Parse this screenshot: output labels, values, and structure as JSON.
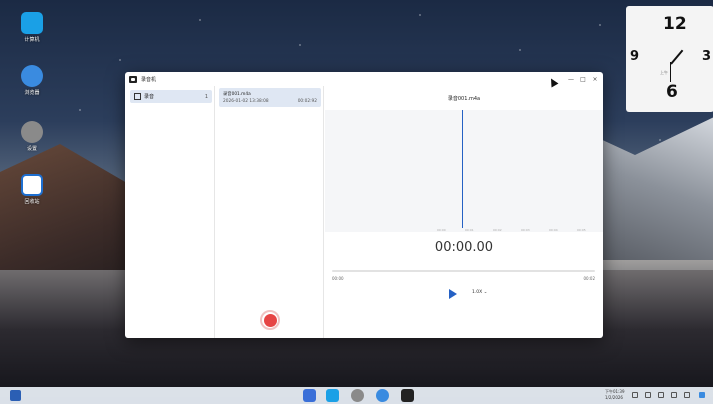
{
  "desktop": {
    "icons": [
      {
        "label": "计算机",
        "name": "computer-icon",
        "color": "#1aa0e6"
      },
      {
        "label": "浏览器",
        "name": "browser-icon",
        "color": "#3a8be0"
      },
      {
        "label": "设置",
        "name": "settings-icon",
        "color": "#8a8a8a"
      },
      {
        "label": "回收站",
        "name": "trash-icon",
        "color": "#1e6fd0"
      }
    ]
  },
  "clock": {
    "numbers": [
      "12",
      "9",
      "3",
      "6"
    ],
    "time_label": "上午"
  },
  "window": {
    "title": "录音机",
    "controls": {
      "minimize": "—",
      "maximize": "□",
      "close": "×"
    },
    "sidebar": {
      "items": [
        {
          "label": "录音",
          "count": "1"
        }
      ]
    },
    "files": [
      {
        "name": "录音001.m4a",
        "date": "2026-01-02 13:38:08",
        "duration": "00:02:92"
      }
    ],
    "player": {
      "file_title": "录音001.m4a",
      "ruler_ticks": [
        "00:00",
        "00:01",
        "00:02",
        "00:03",
        "00:04",
        "00:05"
      ],
      "current_time": "00:00.00",
      "start_time": "00:00",
      "end_time": "00:02",
      "speed": "1.0X ⌄",
      "progress_fraction": 0
    },
    "accent": "#2561c4",
    "record_color": "#e64545"
  },
  "taskbar": {
    "clock_time": "下午01:39",
    "clock_date": "1/2/2026",
    "dock_icons": [
      {
        "name": "launcher-grid-icon",
        "color": "#3a6fd8"
      },
      {
        "name": "computer-icon",
        "color": "#1aa0e6"
      },
      {
        "name": "settings-icon",
        "color": "#8a8a8a"
      },
      {
        "name": "browser-icon",
        "color": "#3a8be0"
      },
      {
        "name": "voice-recorder-icon",
        "color": "#222222"
      }
    ]
  }
}
